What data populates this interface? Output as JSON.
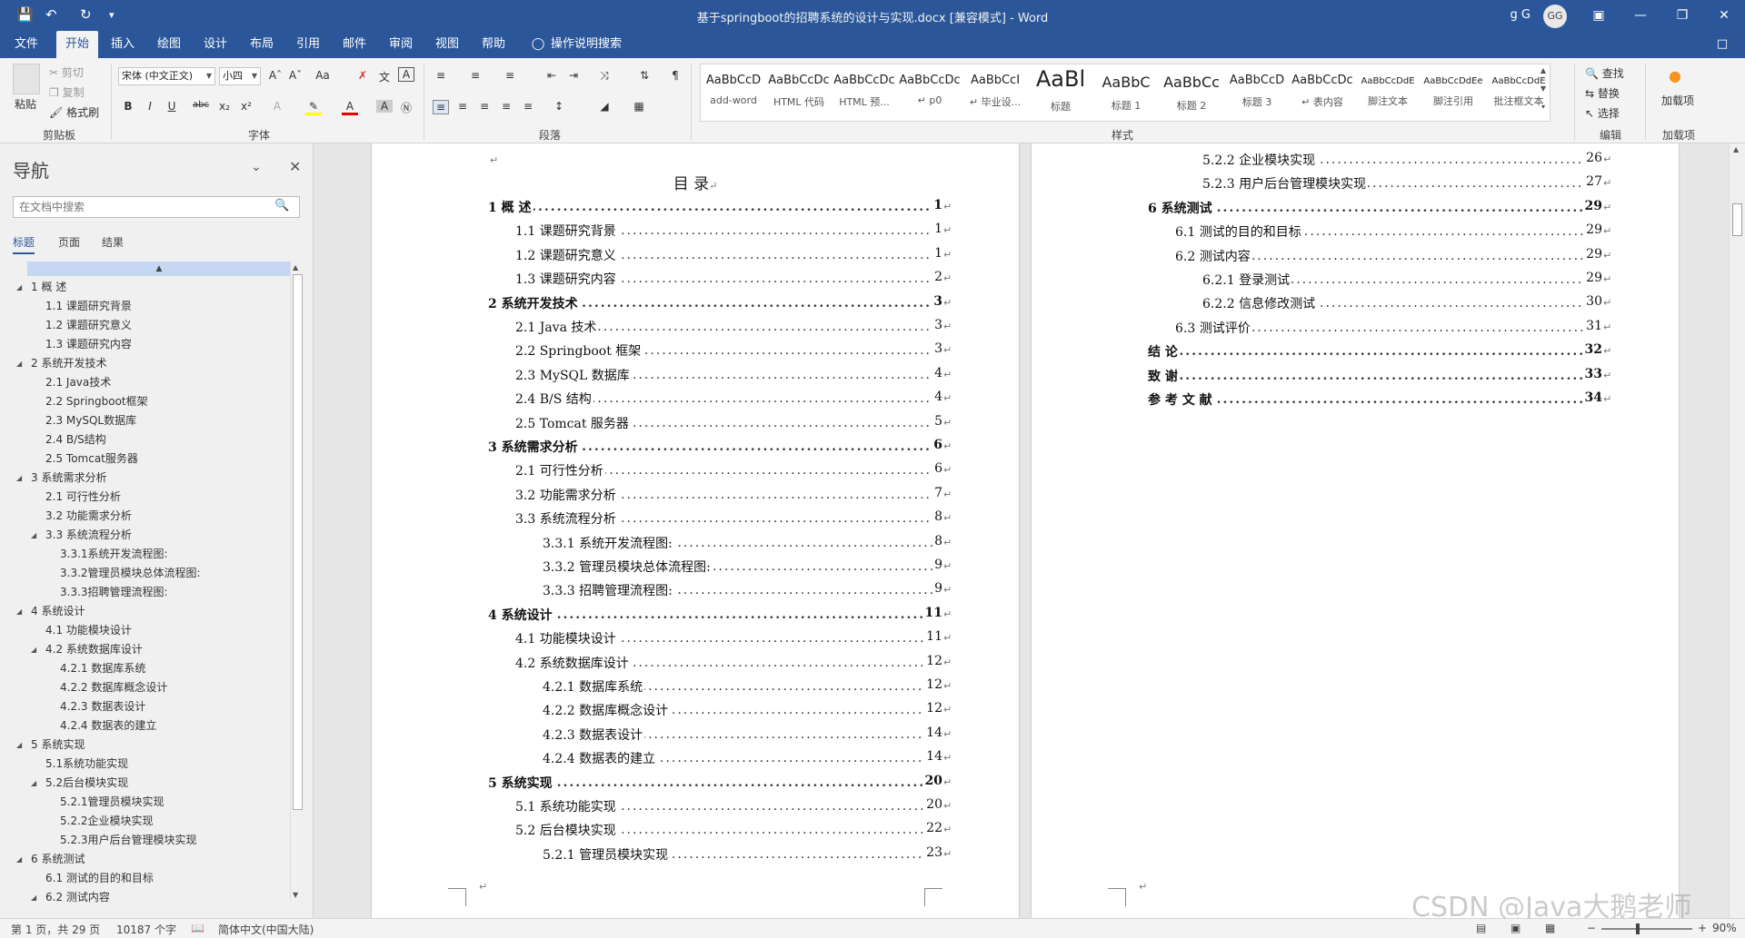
{
  "window": {
    "title": "基于springboot的招聘系统的设计与实现.docx [兼容模式]  -  Word",
    "user_name": "g G",
    "user_initials": "GG"
  },
  "tabs": [
    "文件",
    "开始",
    "插入",
    "绘图",
    "设计",
    "布局",
    "引用",
    "邮件",
    "审阅",
    "视图",
    "帮助"
  ],
  "tell_me": "操作说明搜索",
  "ribbon": {
    "clipboard": {
      "paste": "粘贴",
      "cut": "剪切",
      "copy": "复制",
      "format_painter": "格式刷",
      "label": "剪贴板"
    },
    "font": {
      "name": "宋体 (中文正文)",
      "size": "小四",
      "label": "字体"
    },
    "paragraph": {
      "label": "段落"
    },
    "styles": {
      "label": "样式",
      "items": [
        {
          "sample": "AaBbCcD",
          "name": "add-word"
        },
        {
          "sample": "AaBbCcDc",
          "name": "HTML 代码"
        },
        {
          "sample": "AaBbCcDc",
          "name": "HTML 预..."
        },
        {
          "sample": "AaBbCcDc",
          "name": "↵ p0"
        },
        {
          "sample": "AaBbCcI",
          "name": "↵ 毕业设..."
        },
        {
          "sample": "AaBl",
          "name": "标题"
        },
        {
          "sample": "AaBbC",
          "name": "标题 1"
        },
        {
          "sample": "AaBbCc",
          "name": "标题 2"
        },
        {
          "sample": "AaBbCcD",
          "name": "标题 3"
        },
        {
          "sample": "AaBbCcDc",
          "name": "↵ 表内容"
        },
        {
          "sample": "AaBbCcDdE",
          "name": "脚注文本"
        },
        {
          "sample": "AaBbCcDdEe",
          "name": "脚注引用"
        },
        {
          "sample": "AaBbCcDdE",
          "name": "批注框文本"
        }
      ]
    },
    "editing": {
      "find": "查找",
      "replace": "替换",
      "select": "选择",
      "label": "编辑"
    },
    "addins": {
      "button": "加载项",
      "label": "加载项"
    }
  },
  "nav": {
    "title": "导航",
    "search_placeholder": "在文档中搜索",
    "tabs": [
      "标题",
      "页面",
      "结果"
    ],
    "items": [
      {
        "level": 1,
        "text": "1  概    述"
      },
      {
        "level": 2,
        "text": "1.1 课题研究背景"
      },
      {
        "level": 2,
        "text": "1.2 课题研究意义"
      },
      {
        "level": 2,
        "text": "1.3 课题研究内容"
      },
      {
        "level": 1,
        "text": "2  系统开发技术"
      },
      {
        "level": 2,
        "text": "2.1 Java技术"
      },
      {
        "level": 2,
        "text": "2.2 Springboot框架"
      },
      {
        "level": 2,
        "text": "2.3 MySQL数据库"
      },
      {
        "level": 2,
        "text": "2.4 B/S结构"
      },
      {
        "level": 2,
        "text": "2.5 Tomcat服务器"
      },
      {
        "level": 1,
        "text": "3  系统需求分析"
      },
      {
        "level": 2,
        "text": "2.1 可行性分析"
      },
      {
        "level": 2,
        "text": "3.2 功能需求分析"
      },
      {
        "level": 2,
        "text": "3.3 系统流程分析",
        "expand": true
      },
      {
        "level": 3,
        "text": "3.3.1系统开发流程图:"
      },
      {
        "level": 3,
        "text": "3.3.2管理员模块总体流程图:"
      },
      {
        "level": 3,
        "text": "3.3.3招聘管理流程图:"
      },
      {
        "level": 1,
        "text": "4  系统设计"
      },
      {
        "level": 2,
        "text": "4.1 功能模块设计"
      },
      {
        "level": 2,
        "text": "4.2 系统数据库设计",
        "expand": true
      },
      {
        "level": 3,
        "text": "4.2.1 数据库系统"
      },
      {
        "level": 3,
        "text": "4.2.2 数据库概念设计"
      },
      {
        "level": 3,
        "text": "4.2.3 数据表设计"
      },
      {
        "level": 3,
        "text": "4.2.4 数据表的建立"
      },
      {
        "level": 1,
        "text": "5  系统实现"
      },
      {
        "level": 2,
        "text": "5.1系统功能实现"
      },
      {
        "level": 2,
        "text": "5.2后台模块实现",
        "expand": true
      },
      {
        "level": 3,
        "text": "5.2.1管理员模块实现"
      },
      {
        "level": 3,
        "text": "5.2.2企业模块实现"
      },
      {
        "level": 3,
        "text": "5.2.3用户后台管理模块实现"
      },
      {
        "level": 1,
        "text": "6  系统测试"
      },
      {
        "level": 2,
        "text": "6.1 测试的目的和目标"
      },
      {
        "level": 2,
        "text": "6.2 测试内容",
        "expand": true
      }
    ]
  },
  "toc": {
    "heading": "目    录",
    "page1": [
      {
        "level": 1,
        "text": "1  概    述",
        "page": "1"
      },
      {
        "level": 2,
        "text": "1.1 课题研究背景",
        "page": "1"
      },
      {
        "level": 2,
        "text": "1.2 课题研究意义",
        "page": "1"
      },
      {
        "level": 2,
        "text": "1.3 课题研究内容",
        "page": "2"
      },
      {
        "level": 1,
        "text": "2  系统开发技术",
        "page": "3"
      },
      {
        "level": 2,
        "text": "2.1 Java 技术",
        "page": "3"
      },
      {
        "level": 2,
        "text": "2.2 Springboot 框架",
        "page": "3"
      },
      {
        "level": 2,
        "text": "2.3 MySQL 数据库",
        "page": "4"
      },
      {
        "level": 2,
        "text": "2.4 B/S 结构",
        "page": "4"
      },
      {
        "level": 2,
        "text": "2.5 Tomcat 服务器",
        "page": "5"
      },
      {
        "level": 1,
        "text": "3  系统需求分析",
        "page": "6"
      },
      {
        "level": 2,
        "text": "2.1 可行性分析",
        "page": "6"
      },
      {
        "level": 2,
        "text": "3.2 功能需求分析",
        "page": "7"
      },
      {
        "level": 2,
        "text": "3.3 系统流程分析",
        "page": "8"
      },
      {
        "level": 3,
        "text": "3.3.1 系统开发流程图:",
        "page": "8"
      },
      {
        "level": 3,
        "text": "3.3.2 管理员模块总体流程图:",
        "page": "9"
      },
      {
        "level": 3,
        "text": "3.3.3 招聘管理流程图:",
        "page": "9"
      },
      {
        "level": 1,
        "text": "4  系统设计",
        "page": "11"
      },
      {
        "level": 2,
        "text": "4.1 功能模块设计",
        "page": "11"
      },
      {
        "level": 2,
        "text": "4.2 系统数据库设计",
        "page": "12"
      },
      {
        "level": 3,
        "text": "4.2.1 数据库系统",
        "page": "12"
      },
      {
        "level": 3,
        "text": "4.2.2 数据库概念设计",
        "page": "12"
      },
      {
        "level": 3,
        "text": "4.2.3 数据表设计",
        "page": "14"
      },
      {
        "level": 3,
        "text": "4.2.4 数据表的建立",
        "page": "14"
      },
      {
        "level": 1,
        "text": "5  系统实现",
        "page": "20"
      },
      {
        "level": 2,
        "text": "5.1 系统功能实现",
        "page": "20"
      },
      {
        "level": 2,
        "text": "5.2 后台模块实现",
        "page": "22"
      },
      {
        "level": 3,
        "text": "5.2.1 管理员模块实现",
        "page": "23"
      }
    ],
    "page2": [
      {
        "level": 3,
        "text": "5.2.2 企业模块实现",
        "page": "26"
      },
      {
        "level": 3,
        "text": "5.2.3 用户后台管理模块实现",
        "page": "27"
      },
      {
        "level": 1,
        "text": "6  系统测试",
        "page": "29"
      },
      {
        "level": 2,
        "text": "6.1 测试的目的和目标",
        "page": "29"
      },
      {
        "level": 2,
        "text": "6.2 测试内容",
        "page": "29"
      },
      {
        "level": 3,
        "text": "6.2.1 登录测试",
        "page": "29"
      },
      {
        "level": 3,
        "text": "6.2.2 信息修改测试",
        "page": "30"
      },
      {
        "level": 2,
        "text": "6.3 测试评价",
        "page": "31"
      },
      {
        "level": 1,
        "text": "结    论",
        "page": "32"
      },
      {
        "level": 1,
        "text": "致    谢",
        "page": "33"
      },
      {
        "level": 1,
        "text": "参 考 文 献",
        "page": "34"
      }
    ]
  },
  "status": {
    "page": "第 1 页，共 29 页",
    "words": "10187 个字",
    "language": "简体中文(中国大陆)",
    "zoom": "90%"
  },
  "watermark": "CSDN @Java大鹅老师",
  "colors": {
    "brand": "#2b579a",
    "ribbon": "#f3f3f3",
    "page_bg": "#e6e6e6"
  }
}
